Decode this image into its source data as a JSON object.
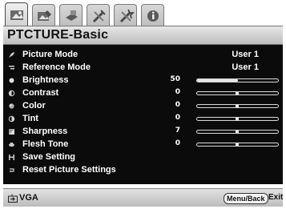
{
  "window": {
    "title": "PTCTURE-Basic"
  },
  "tabs": [
    {
      "name": "picture-tab-icon",
      "active": true
    },
    {
      "name": "picture-advanced-tab-icon",
      "active": false
    },
    {
      "name": "display-tab-icon",
      "active": false
    },
    {
      "name": "setup-tab-icon",
      "active": false
    },
    {
      "name": "setup-advanced-tab-icon",
      "active": false
    },
    {
      "name": "information-tab-icon",
      "active": false
    }
  ],
  "menu": {
    "items": [
      {
        "label": "Picture Mode",
        "value": "User 1",
        "kind": "text",
        "icon": "picture-mode-icon"
      },
      {
        "label": "Reference Mode",
        "value": "User 1",
        "kind": "text",
        "icon": "reference-mode-icon"
      },
      {
        "label": "Brightness",
        "value": "50",
        "kind": "slider",
        "level": 0.5,
        "icon": "brightness-icon"
      },
      {
        "label": "Contrast",
        "value": "0",
        "kind": "slider",
        "level": 0.5,
        "icon": "contrast-icon"
      },
      {
        "label": "Color",
        "value": "0",
        "kind": "slider",
        "level": 0.5,
        "icon": "color-icon"
      },
      {
        "label": "Tint",
        "value": "0",
        "kind": "slider",
        "level": 0.5,
        "icon": "tint-icon"
      },
      {
        "label": "Sharpness",
        "value": "7",
        "kind": "slider",
        "level": 0.5,
        "icon": "sharpness-icon"
      },
      {
        "label": "Flesh Tone",
        "value": "0",
        "kind": "slider",
        "level": 0.5,
        "icon": "flesh-tone-icon"
      },
      {
        "label": "Save Setting",
        "value": "",
        "kind": "action",
        "icon": "save-icon"
      },
      {
        "label": "Reset Picture Settings",
        "value": "",
        "kind": "action",
        "icon": "reset-icon"
      }
    ]
  },
  "footer": {
    "source": "VGA",
    "back_label": "Menu/Back",
    "exit_label": "Exit"
  },
  "colors": {
    "panel": "#0b0b0b",
    "text": "#ffffff",
    "bar": "#d8d8d8"
  }
}
